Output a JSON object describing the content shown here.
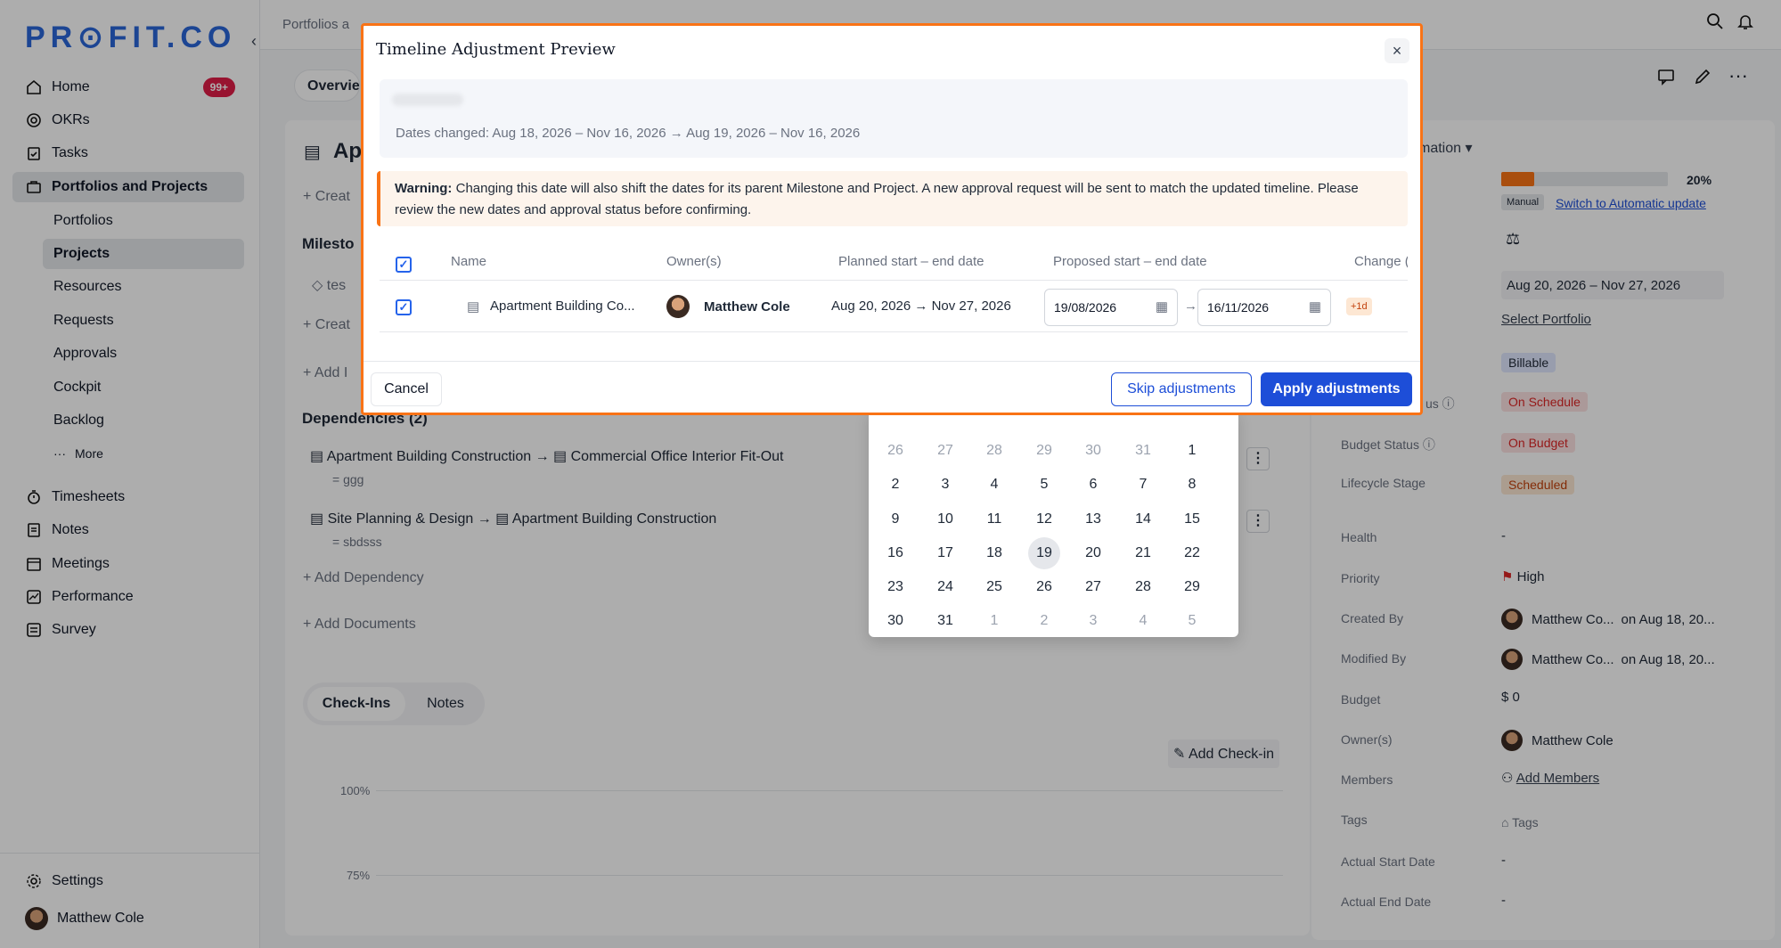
{
  "app": {
    "logo": "PR⊙FIT.CO"
  },
  "sidebar": {
    "items": [
      {
        "label": "Home",
        "badge": "99+"
      },
      {
        "label": "OKRs"
      },
      {
        "label": "Tasks"
      },
      {
        "label": "Portfolios and Projects"
      }
    ],
    "sub_items": [
      "Portfolios",
      "Projects",
      "Resources",
      "Requests",
      "Approvals",
      "Cockpit",
      "Backlog",
      "More"
    ],
    "lower_items": [
      "Timesheets",
      "Notes",
      "Meetings",
      "Performance",
      "Survey"
    ],
    "settings": "Settings",
    "user": "Matthew Cole"
  },
  "header": {
    "breadcrumb": "Portfolios a"
  },
  "background": {
    "tab_overview": "Overvie",
    "title_fragment": "Ap",
    "create_1": "Creat",
    "milestones": "Milesto",
    "milestone_item": "tes",
    "create_2": "Creat",
    "add_1": "Add I",
    "dependencies": "Dependencies (2)",
    "dep1_from": "Apartment Building Construction",
    "dep1_to": "Commercial Office Interior Fit-Out",
    "dep1_sub": "ggg",
    "dep2_from": "Site Planning & Design",
    "dep2_to": "Apartment Building Construction",
    "dep2_sub": "sbdsss",
    "add_dependency": "Add Dependency",
    "add_documents": "Add Documents",
    "tab_checkins": "Check-Ins",
    "tab_notes": "Notes",
    "add_checkin": "Add Check-in",
    "y_100": "100%",
    "y_75": "75%"
  },
  "details": {
    "automation_fragment": "mation",
    "progress_pct": "20%",
    "progress_value": 0.2,
    "manual_tag": "Manual",
    "switch_link": "Switch to Automatic update",
    "date_range": "Aug 20, 2026 – Nov 27, 2026",
    "select_portfolio": "Select Portfolio",
    "billable": "Billable",
    "status_fragment": "us",
    "on_schedule": "On Schedule",
    "budget_status_label": "Budget Status",
    "on_budget": "On Budget",
    "lifecycle_label": "Lifecycle Stage",
    "lifecycle_value": "Scheduled",
    "health_label": "Health",
    "health_value": "-",
    "priority_label": "Priority",
    "priority_value": "High",
    "created_by_label": "Created By",
    "created_by_value": "Matthew Co...",
    "created_on": "on Aug 18, 20...",
    "modified_by_label": "Modified By",
    "modified_by_value": "Matthew Co...",
    "modified_on": "on Aug 18, 20...",
    "budget_label": "Budget",
    "budget_value": "$ 0",
    "owners_label": "Owner(s)",
    "owners_value": "Matthew Cole",
    "members_label": "Members",
    "members_value": "Add Members",
    "tags_label": "Tags",
    "tags_value": "Tags",
    "actual_start_label": "Actual Start Date",
    "actual_start_value": "-",
    "actual_end_label": "Actual End Date",
    "actual_end_value": "-"
  },
  "calendar": {
    "rows": [
      [
        "26",
        "27",
        "28",
        "29",
        "30",
        "31",
        "1"
      ],
      [
        "2",
        "3",
        "4",
        "5",
        "6",
        "7",
        "8"
      ],
      [
        "9",
        "10",
        "11",
        "12",
        "13",
        "14",
        "15"
      ],
      [
        "16",
        "17",
        "18",
        "19",
        "20",
        "21",
        "22"
      ],
      [
        "23",
        "24",
        "25",
        "26",
        "27",
        "28",
        "29"
      ],
      [
        "30",
        "31",
        "1",
        "2",
        "3",
        "4",
        "5"
      ]
    ],
    "selected": "19"
  },
  "modal": {
    "title": "Timeline Adjustment Preview",
    "close": "×",
    "dates_changed": "Dates changed: Aug 18, 2026 – Nov 16, 2026 → Aug 19, 2026 – Nov 16, 2026",
    "warning_label": "Warning:",
    "warning_text": " Changing this date will also shift the dates for its parent Milestone and Project. A new approval request will be sent to match the updated timeline. Please review the new dates and approval status before confirming.",
    "columns": [
      "Name",
      "Owner(s)",
      "Planned start – end date",
      "Proposed start – end date",
      "Change ("
    ],
    "row": {
      "name": "Apartment Building Co...",
      "owner": "Matthew Cole",
      "planned": "Aug 20, 2026 → Nov 27, 2026",
      "proposed_start": "19/08/2026",
      "proposed_end": "16/11/2026",
      "change": "+1d"
    },
    "cancel": "Cancel",
    "skip": "Skip adjustments",
    "apply": "Apply adjustments"
  },
  "colors": {
    "accent": "#1d4ed8",
    "modal_border": "#f97316",
    "warning_bg": "#fdf4ec",
    "progress_fill": "#f97316"
  }
}
